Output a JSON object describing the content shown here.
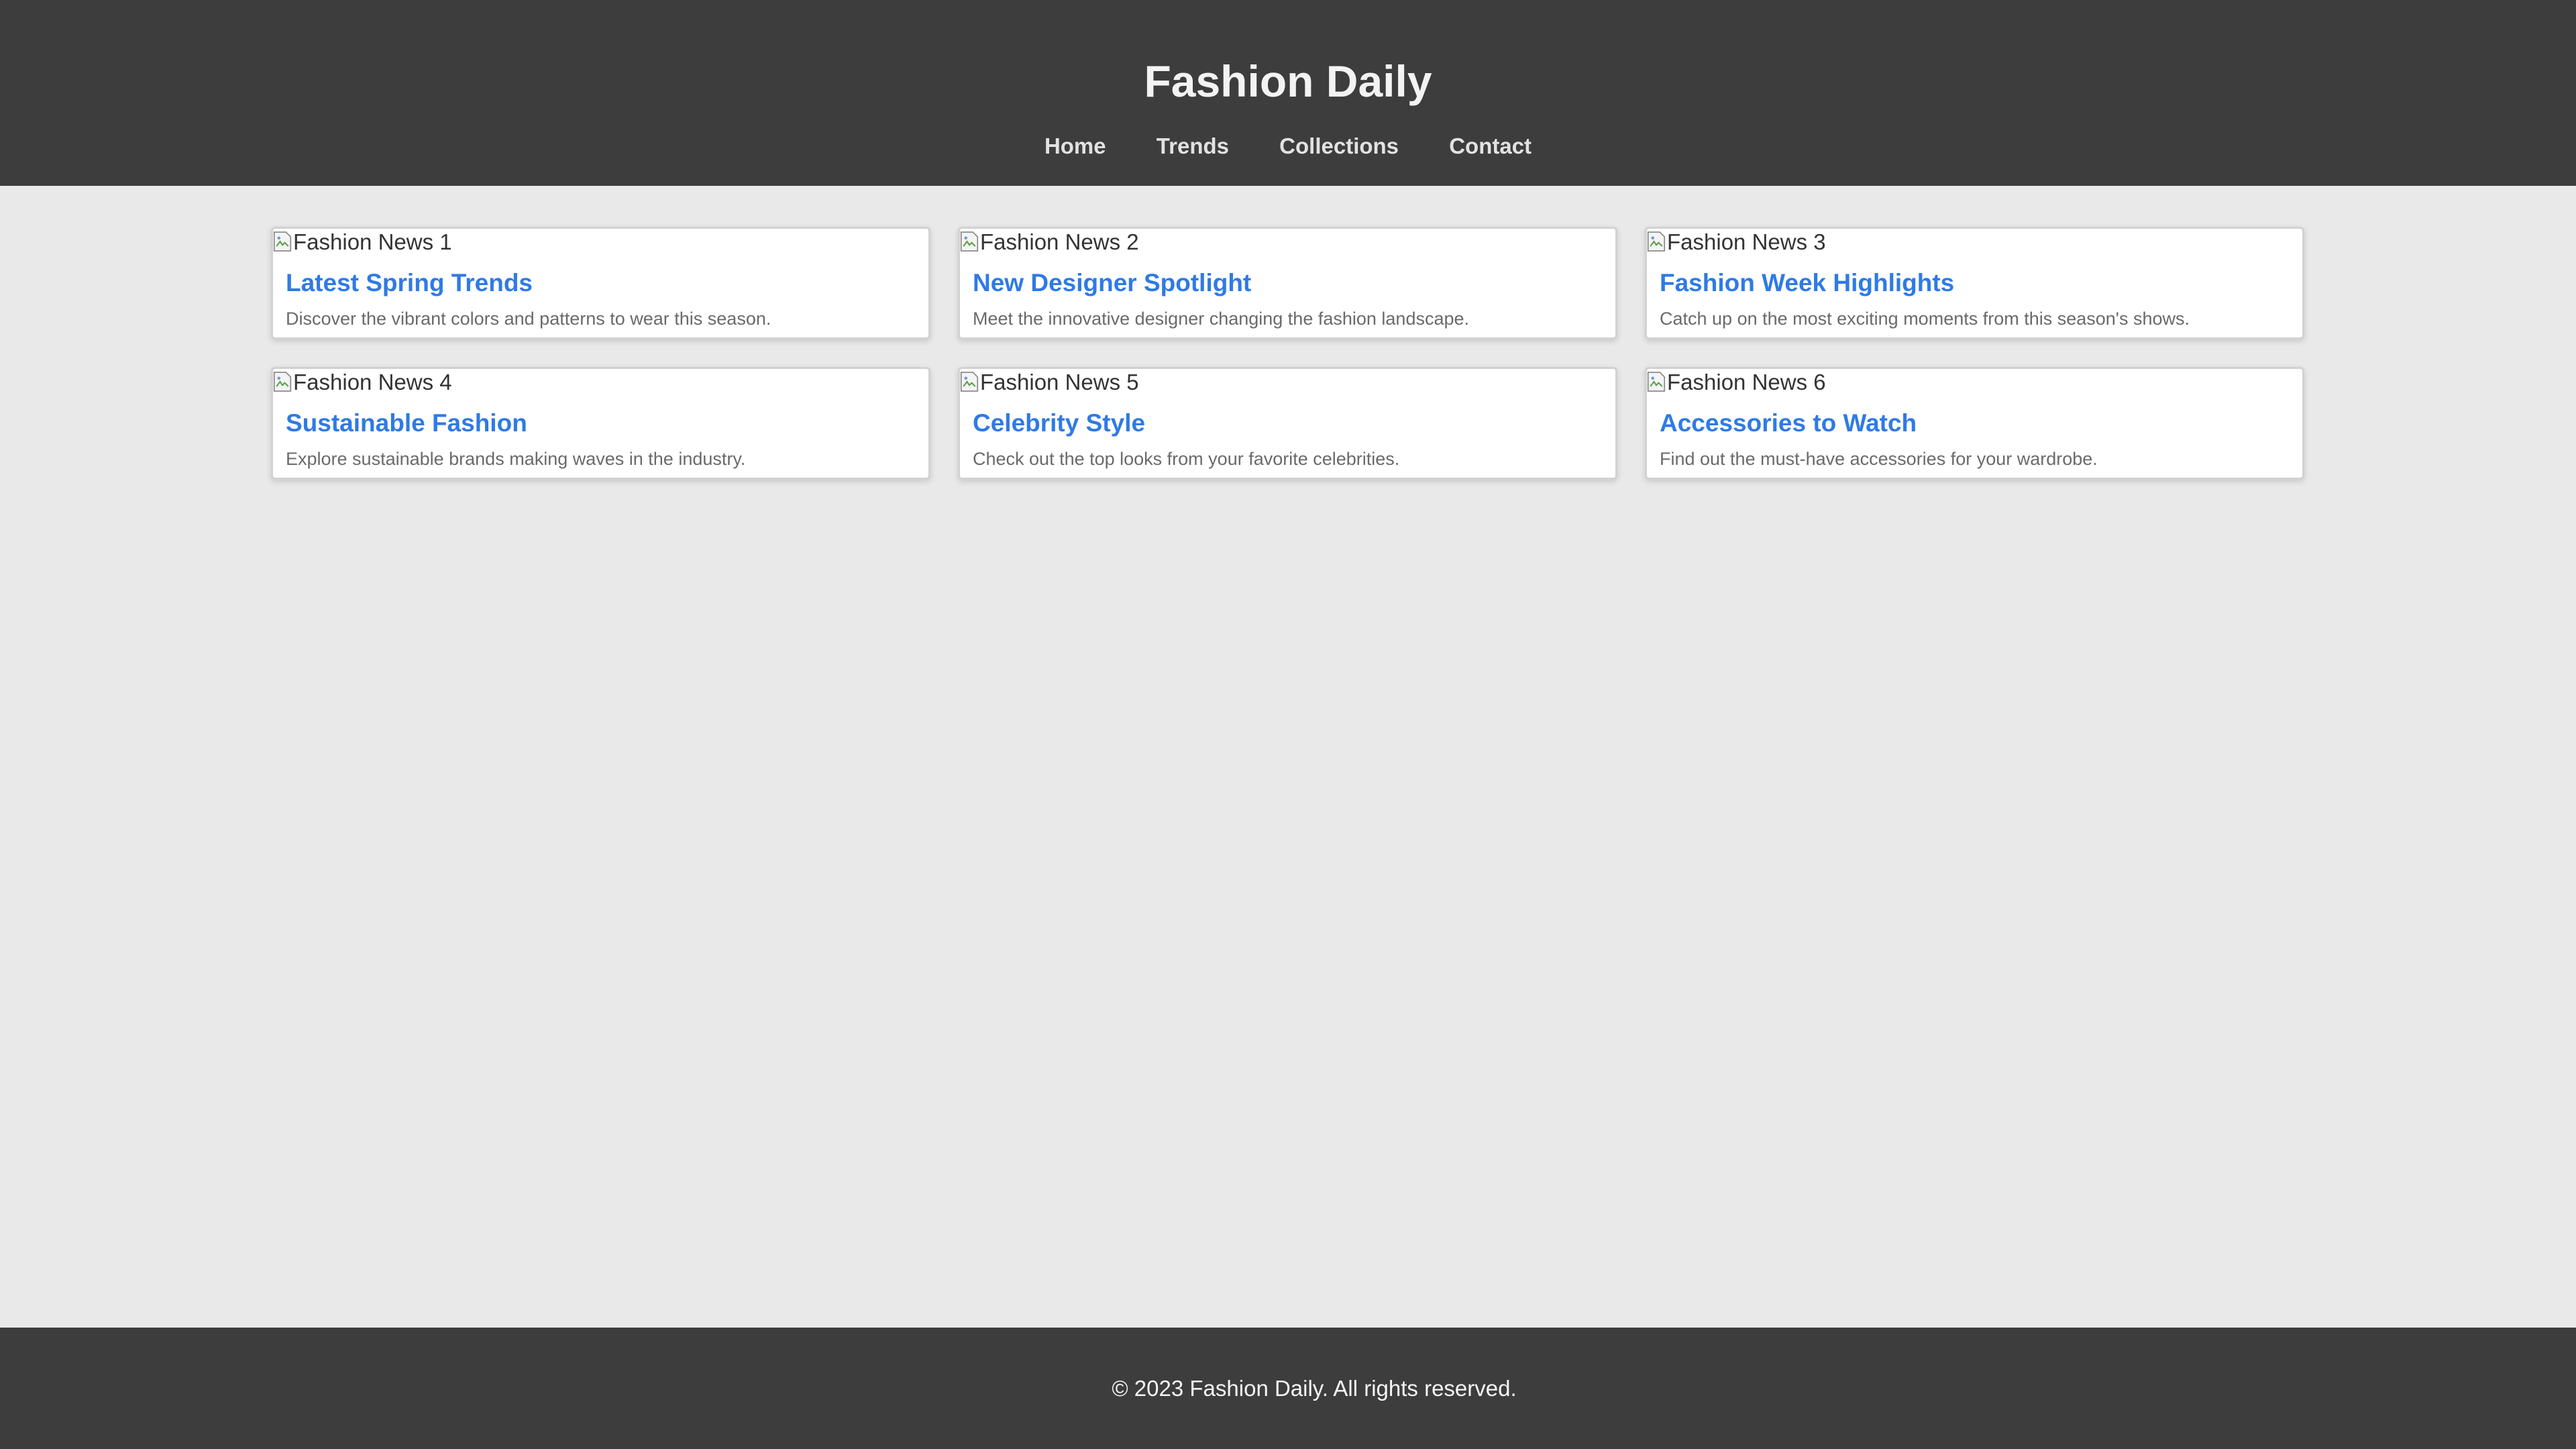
{
  "header": {
    "title": "Fashion Daily",
    "nav": [
      "Home",
      "Trends",
      "Collections",
      "Contact"
    ]
  },
  "cards": [
    {
      "image_alt": "Fashion News 1",
      "title": "Latest Spring Trends",
      "description": "Discover the vibrant colors and patterns to wear this season."
    },
    {
      "image_alt": "Fashion News 2",
      "title": "New Designer Spotlight",
      "description": "Meet the innovative designer changing the fashion landscape."
    },
    {
      "image_alt": "Fashion News 3",
      "title": "Fashion Week Highlights",
      "description": "Catch up on the most exciting moments from this season's shows."
    },
    {
      "image_alt": "Fashion News 4",
      "title": "Sustainable Fashion",
      "description": "Explore sustainable brands making waves in the industry."
    },
    {
      "image_alt": "Fashion News 5",
      "title": "Celebrity Style",
      "description": "Check out the top looks from your favorite celebrities."
    },
    {
      "image_alt": "Fashion News 6",
      "title": "Accessories to Watch",
      "description": "Find out the must-have accessories for your wardrobe."
    }
  ],
  "footer": {
    "text": "© 2023 Fashion Daily. All rights reserved."
  },
  "colors": {
    "header_bg": "#3d3d3d",
    "page_bg": "#e9e9e9",
    "card_title": "#2f7ae5",
    "card_desc": "#6a6a6a"
  },
  "icons": {
    "card_image": "broken-image-icon"
  }
}
